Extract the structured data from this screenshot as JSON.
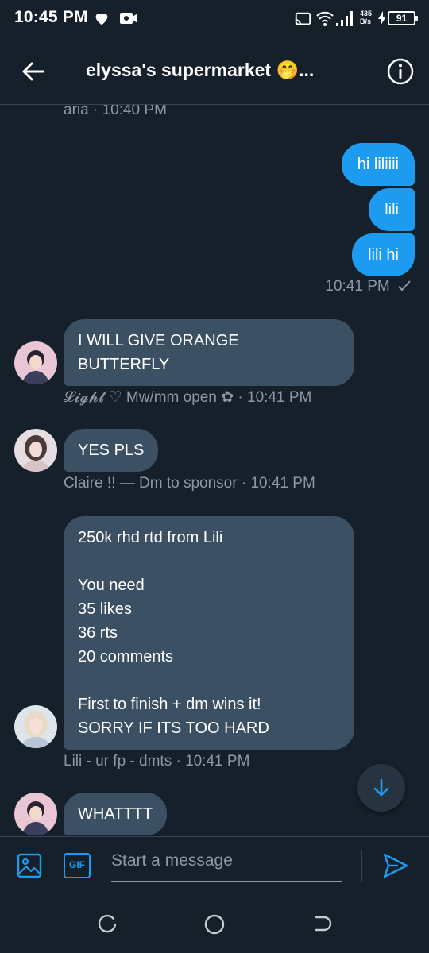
{
  "status_bar": {
    "time": "10:45 PM",
    "speed_value": "435",
    "speed_unit": "B/s",
    "battery": "91",
    "icons": [
      "heart-icon",
      "video-camera-icon",
      "cast-icon",
      "wifi-icon",
      "signal-icon",
      "charging-icon",
      "battery-icon"
    ]
  },
  "header": {
    "title": "elyssa's supermarket 🤭...",
    "back_icon": "arrow-left-icon",
    "info_icon": "info-icon"
  },
  "messages": {
    "top_meta": "aria · 10:40 PM",
    "outgoing": [
      "hi liliiii",
      "lili",
      "lili hi"
    ],
    "outgoing_meta": "10:41 PM",
    "msg1": {
      "text": "I WILL GIVE ORANGE\nBUTTERFLY",
      "meta": "𝓛𝓲𝓰𝓱𝓽 ♡ Mw/mm open ✿ · 10:41 PM"
    },
    "msg2": {
      "text": "YES PLS",
      "meta": "Claire !! — Dm to sponsor · 10:41 PM"
    },
    "msg3": {
      "text": "250k rhd rtd from Lili\n\nYou need\n35 likes\n36 rts\n20 comments\n\nFirst to finish + dm wins it!\nSORRY IF ITS TOO HARD",
      "meta": "Lili - ur fp - dmts · 10:41 PM"
    },
    "msg4": {
      "text": "WHATTTT"
    }
  },
  "composer": {
    "placeholder": "Start a message",
    "gif_label": "GIF"
  },
  "colors": {
    "background": "#15202b",
    "outgoing_bubble": "#1d9bf0",
    "incoming_bubble": "#3c5063",
    "meta_text": "#8b98a5",
    "accent": "#1d9bf0"
  }
}
